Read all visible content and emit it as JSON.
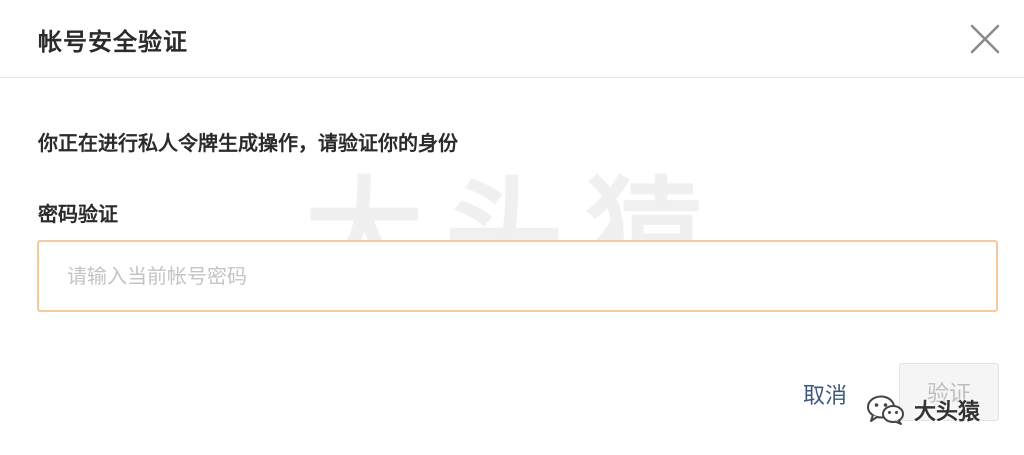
{
  "dialog": {
    "title": "帐号安全验证",
    "close_icon": "close-icon"
  },
  "watermark": "大头猿",
  "form": {
    "prompt": "你正在进行私人令牌生成操作，请验证你的身份",
    "password_label": "密码验证",
    "password_value": "",
    "password_placeholder": "请输入当前帐号密码"
  },
  "actions": {
    "cancel_label": "取消",
    "verify_label": "验证"
  },
  "brand": {
    "icon": "wechat-icon",
    "text": "大头猿"
  },
  "colors": {
    "input_border": "#f7c9a0",
    "link": "#3c5a80",
    "disabled_button_bg": "#f5f5f5",
    "disabled_button_text": "#bdbdbd"
  }
}
